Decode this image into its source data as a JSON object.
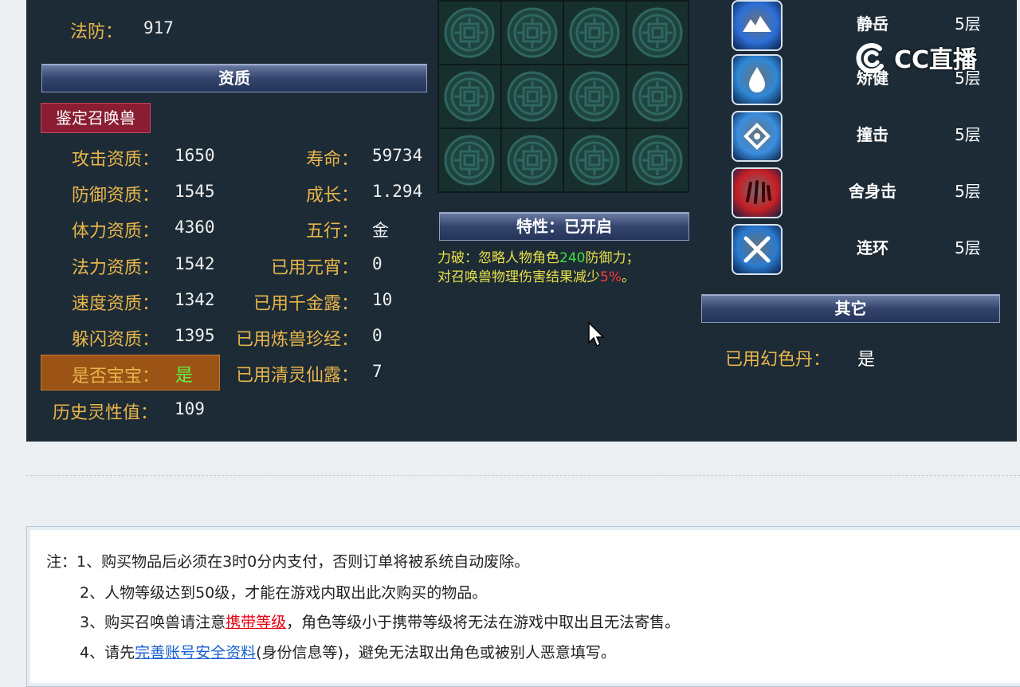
{
  "top": {
    "fafang_label": "法防：",
    "fafang_value": "917"
  },
  "aptitude": {
    "header": "资质",
    "identify_button": "鉴定召唤兽",
    "left": [
      {
        "label": "攻击资质：",
        "value": "1650"
      },
      {
        "label": "防御资质：",
        "value": "1545"
      },
      {
        "label": "体力资质：",
        "value": "4360"
      },
      {
        "label": "法力资质：",
        "value": "1542"
      },
      {
        "label": "速度资质：",
        "value": "1342"
      },
      {
        "label": "躲闪资质：",
        "value": "1395"
      }
    ],
    "baby_label": "是否宝宝：",
    "baby_value": "是",
    "history_label": "历史灵性值：",
    "history_value": "109",
    "right": [
      {
        "label": "寿命：",
        "value": "59734"
      },
      {
        "label": "成长：",
        "value": "1.294"
      },
      {
        "label": "五行：",
        "value": "金"
      },
      {
        "label": "已用元宵：",
        "value": "0"
      },
      {
        "label": "已用千金露：",
        "value": "10"
      },
      {
        "label": "已用炼兽珍经：",
        "value": "0"
      },
      {
        "label": "已用清灵仙露：",
        "value": "7"
      }
    ]
  },
  "trait": {
    "header": "特性：已开启",
    "line1_a": "力破：忽略人物角色",
    "line1_num": "240",
    "line1_b": "防御力；",
    "line2_a": "对召唤兽物理伤害结果减少",
    "line2_num": "5%",
    "line2_b": "。"
  },
  "skills": [
    {
      "name": "静岳",
      "level": "5层",
      "icon": "mountain-skill-icon",
      "color": "#2d6fd8"
    },
    {
      "name": "矫健",
      "level": "5层",
      "icon": "water-skill-icon",
      "color": "#2f88d6"
    },
    {
      "name": "撞击",
      "level": "5层",
      "icon": "impact-skill-icon",
      "color": "#3a8ee0"
    },
    {
      "name": "舍身击",
      "level": "5层",
      "icon": "claw-skill-icon",
      "color": "#c81f25"
    },
    {
      "name": "连环",
      "level": "5层",
      "icon": "swords-skill-icon",
      "color": "#2a7ad0"
    }
  ],
  "other": {
    "header": "其它",
    "label": "已用幻色丹：",
    "value": "是"
  },
  "watermark": "CC直播",
  "notes": {
    "n1": "注：1、购买物品后必须在3时0分内支付，否则订单将被系统自动废除。",
    "n2": "2、人物等级达到50级，才能在游戏内取出此次购买的物品。",
    "n3_a": "3、购买召唤兽请注意",
    "n3_link": "携带等级",
    "n3_b": "，角色等级小于携带等级将无法在游戏中取出且无法寄售。",
    "n4_a": "4、请先",
    "n4_link": "完善账号安全资料",
    "n4_b": "(身份信息等)，避免无法取出角色或被别人恶意填写。"
  }
}
